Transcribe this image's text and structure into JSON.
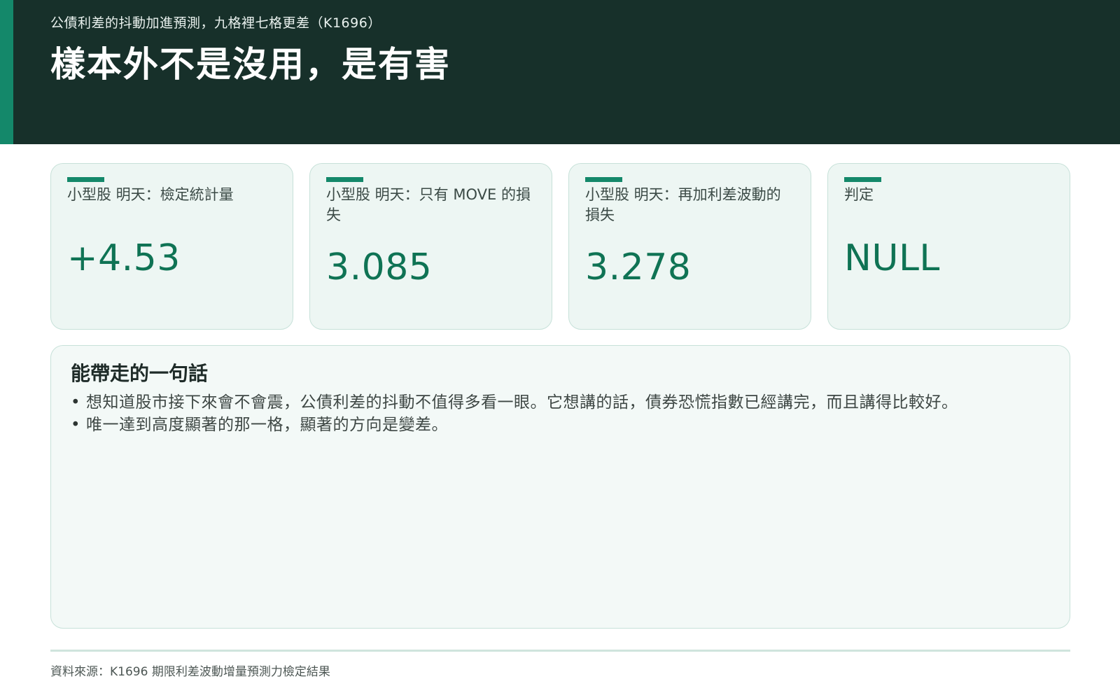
{
  "header": {
    "subtitle": "公債利差的抖動加進預測，九格裡七格更差（K1696）",
    "title": "樣本外不是沒用，是有害",
    "colors": {
      "background": "#17302a",
      "accent": "#14886a"
    }
  },
  "cards": [
    {
      "label": "小型股 明天：檢定統計量",
      "value": "+4.53"
    },
    {
      "label": "小型股 明天：只有 MOVE 的損失",
      "value": "3.085"
    },
    {
      "label": "小型股 明天：再加利差波動的損失",
      "value": "3.278"
    },
    {
      "label": "判定",
      "value": "NULL"
    }
  ],
  "takeaway": {
    "title": "能帶走的一句話",
    "bullet_icon": "bullet-dot",
    "items": [
      "想知道股市接下來會不會震，公債利差的抖動不值得多看一眼。它想講的話，債券恐慌指數已經講完，而且講得比較好。",
      "唯一達到高度顯著的那一格，顯著的方向是變差。"
    ]
  },
  "footer": {
    "source": "資料來源：K1696 期限利差波動增量預測力檢定結果"
  }
}
